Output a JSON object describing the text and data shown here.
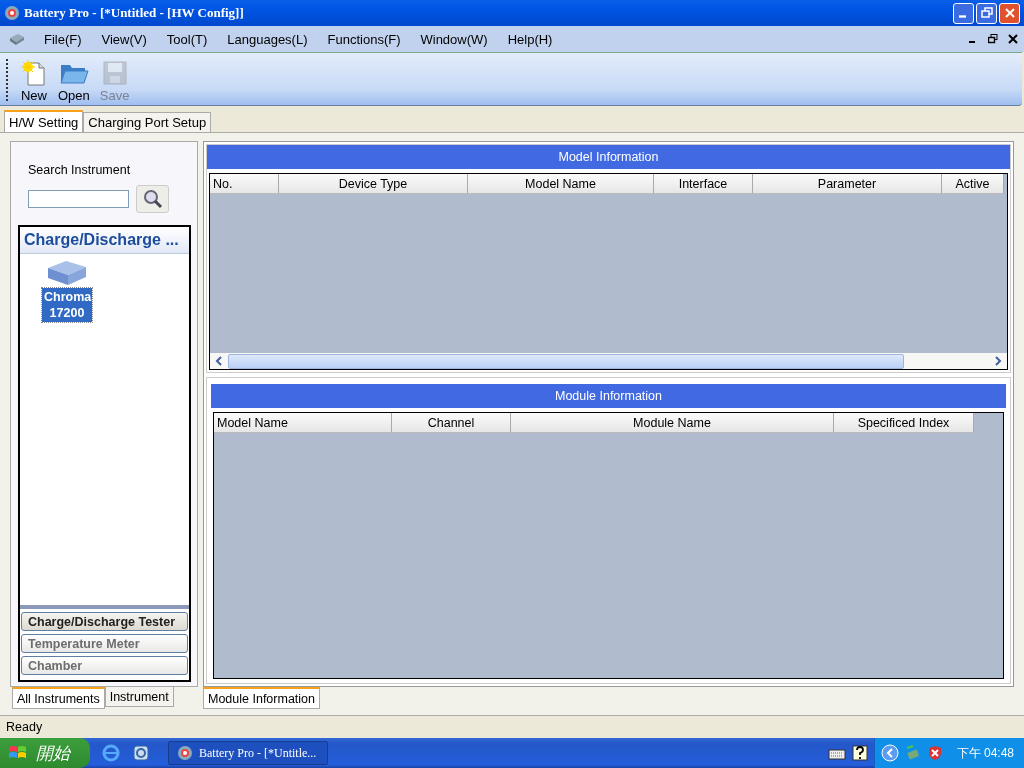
{
  "window": {
    "title": "Battery Pro - [*Untitled - [HW Config]]"
  },
  "menu": [
    "File(F)",
    "View(V)",
    "Tool(T)",
    "Languages(L)",
    "Functions(F)",
    "Window(W)",
    "Help(H)"
  ],
  "toolbar": [
    {
      "kind": "new",
      "label": "New",
      "disabled": false
    },
    {
      "kind": "open",
      "label": "Open",
      "disabled": false
    },
    {
      "kind": "save",
      "label": "Save",
      "disabled": true
    }
  ],
  "tabs": [
    {
      "label": "H/W Setting",
      "selected": true
    },
    {
      "label": "Charging Port Setup",
      "selected": false
    }
  ],
  "sidebar": {
    "search_label": "Search Instrument",
    "group_title": "Charge/Discharge ...",
    "instruments": [
      {
        "label": "Chroma 17200",
        "selected": true
      }
    ],
    "categories": [
      {
        "label": "Charge/Discharge Tester",
        "selected": true
      },
      {
        "label": "Temperature Meter",
        "selected": false
      },
      {
        "label": "Chamber",
        "selected": false
      }
    ],
    "tabs": [
      {
        "label": "All Instruments",
        "selected": true
      },
      {
        "label": "Instrument",
        "selected": false
      }
    ]
  },
  "model_table": {
    "title": "Model Information",
    "columns": [
      "No.",
      "Device Type",
      "Model Name",
      "Interface",
      "Parameter",
      "Active"
    ]
  },
  "module_table": {
    "title": "Module Information",
    "columns": [
      "Model Name",
      "Channel",
      "Module Name",
      "Specificed Index"
    ]
  },
  "bottom_tabs": [
    {
      "label": "Module Information",
      "selected": true
    }
  ],
  "status_bar": "Ready",
  "taskbar": {
    "start": "開始",
    "task": "Battery Pro - [*Untitle...",
    "clock": "下午 04:48"
  }
}
